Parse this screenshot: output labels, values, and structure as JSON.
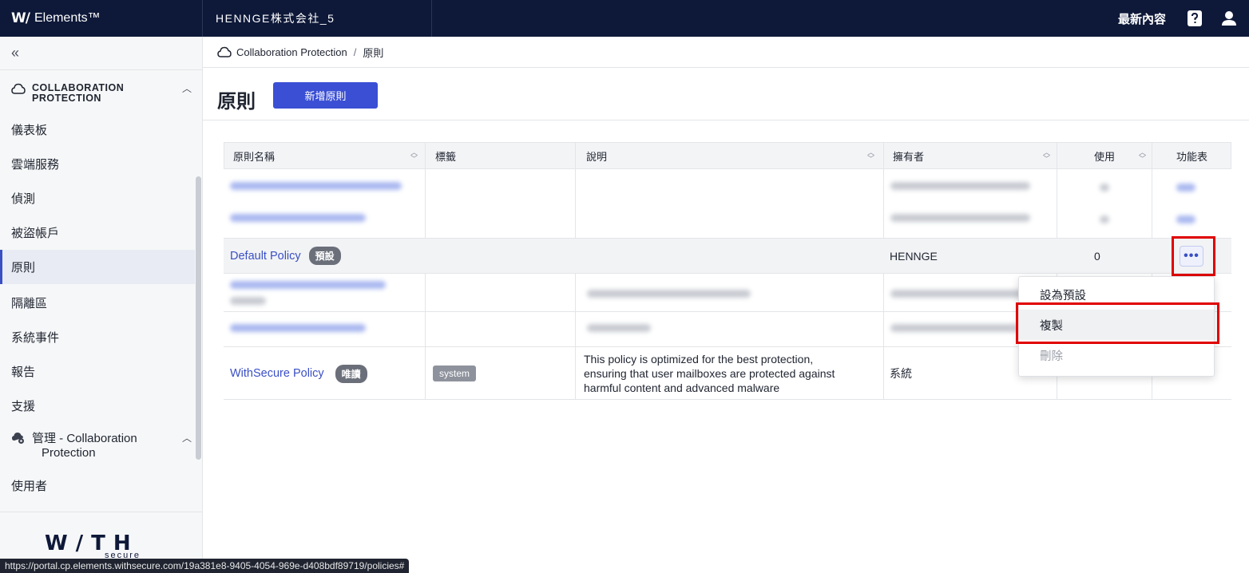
{
  "topbar": {
    "brand_mark": "W/",
    "brand_name": "Elements™",
    "tenant": "HENNGE株式会社_5",
    "latest": "最新內容",
    "help_icon": "help-icon",
    "user_icon": "user-icon"
  },
  "sidebar": {
    "collapse_label": "«",
    "section1_line1": "COLLABORATION",
    "section1_line2": "PROTECTION",
    "items": [
      {
        "label": "儀表板"
      },
      {
        "label": "雲端服務"
      },
      {
        "label": "偵測"
      },
      {
        "label": "被盜帳戶"
      },
      {
        "label": "原則"
      },
      {
        "label": "隔離區"
      },
      {
        "label": "系統事件"
      },
      {
        "label": "報告"
      },
      {
        "label": "支援"
      }
    ],
    "section2_line1": "管理 - Collaboration",
    "section2_line2": "Protection",
    "item_users": "使用者",
    "logo_text": "W/TH",
    "logo_sub": "secure"
  },
  "breadcrumb": {
    "root": "Collaboration Protection",
    "sep": "/",
    "current": "原則"
  },
  "page": {
    "title": "原則",
    "add_button": "新增原則"
  },
  "table": {
    "columns": {
      "name": "原則名稱",
      "tags": "標籤",
      "description": "說明",
      "owner": "擁有者",
      "usage": "使用",
      "menu": "功能表"
    },
    "rows": [
      {
        "name": "Default Policy",
        "badge": "預設",
        "owner": "HENNGE",
        "usage": "0"
      },
      {
        "name": "WithSecure Policy",
        "badge": "唯讀",
        "tag": "system",
        "description_lines": [
          "This policy is optimized for the best protection,",
          "ensuring that user mailboxes are protected against",
          "harmful content and advanced malware"
        ],
        "owner": "系統"
      }
    ],
    "more_label": "•••"
  },
  "menu": {
    "items": [
      {
        "label": "設為預設"
      },
      {
        "label": "複製"
      },
      {
        "label": "刪除"
      }
    ]
  },
  "status_url": "https://portal.cp.elements.withsecure.com/19a381e8-9405-4054-969e-d408bdf89719/policies#",
  "colors": {
    "topbar": "#0e1939",
    "accent": "#3a4fd4",
    "highlight": "#e00000"
  }
}
